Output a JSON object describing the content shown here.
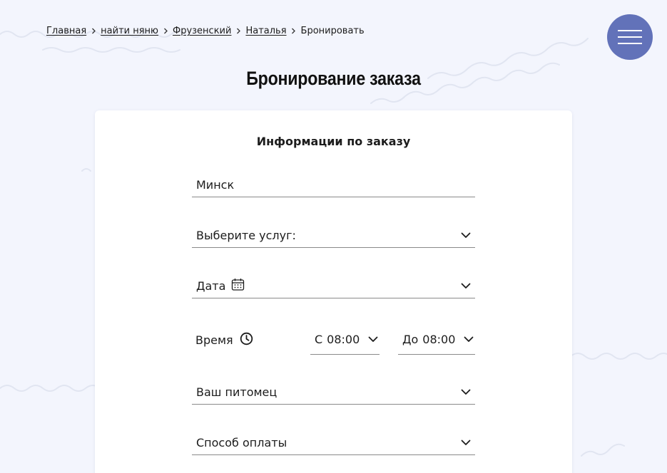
{
  "breadcrumb": {
    "items": [
      "Главная",
      "найти няню",
      "Фрузенский",
      "Наталья"
    ],
    "current": "Бронировать"
  },
  "page": {
    "title": "Бронирование заказа"
  },
  "form": {
    "title": "Информации по заказу",
    "city_value": "Минск",
    "service_placeholder": "Выберите услуг:",
    "date_label": "Дата",
    "time_label": "Время",
    "time_from_prefix": "С",
    "time_from_value": "08:00",
    "time_to_prefix": "До",
    "time_to_value": "08:00",
    "pet_placeholder": "Ваш питомец",
    "payment_placeholder": "Способ оплаты"
  },
  "icons": {
    "menu": "hamburger-icon",
    "calendar": "calendar-icon",
    "clock": "clock-icon",
    "chevron": "chevron-down-icon",
    "breadcrumb_separator": "chevron-right-icon"
  },
  "colors": {
    "background": "#f3f5fd",
    "accent": "#6272b9",
    "card": "#ffffff",
    "text": "#1c1c1c"
  }
}
